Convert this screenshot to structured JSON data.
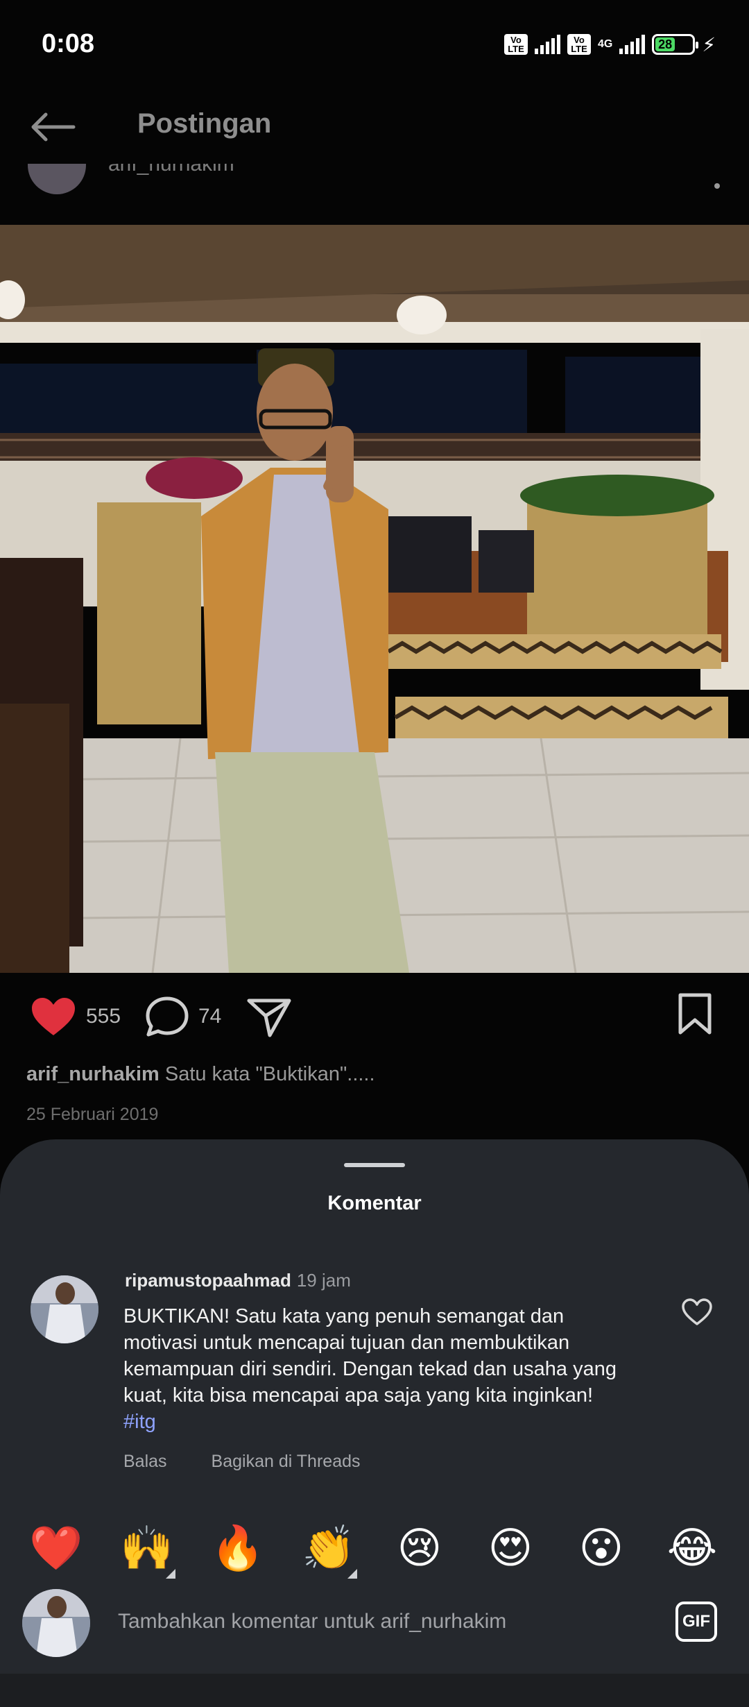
{
  "status_bar": {
    "time": "0:08",
    "sim1_label": "Vo LTE",
    "sim2_label": "Vo LTE",
    "network": "4G",
    "battery_percent": "28",
    "battery_level": 0.28,
    "charging": true
  },
  "header": {
    "title": "Postingan",
    "back_icon": "arrow-left-icon"
  },
  "post": {
    "username": "arif_nurhakim",
    "likes": "555",
    "comments": "74",
    "caption_user": "arif_nurhakim",
    "caption_text": "Satu kata \"Buktikan\".....",
    "date": "25 Februari 2019",
    "colors": {
      "like_heart": "#e0313e"
    }
  },
  "comments_sheet": {
    "title": "Komentar",
    "comment": {
      "username": "ripamustopaahmad",
      "time": "19 jam",
      "text": "BUKTIKAN! Satu kata yang penuh semangat dan motivasi untuk mencapai tujuan dan membuktikan kemampuan diri sendiri. Dengan tekad dan usaha yang kuat, kita bisa mencapai apa saja yang kita inginkan! ",
      "hashtag": "#itg",
      "reply_label": "Balas",
      "share_label": "Bagikan di Threads"
    },
    "emojis": [
      "❤️",
      "🙌",
      "🔥",
      "👏",
      "😢",
      "😍",
      "😮",
      "😂"
    ],
    "input_placeholder": "Tambahkan komentar untuk arif_nurhakim",
    "gif_label": "GIF"
  }
}
